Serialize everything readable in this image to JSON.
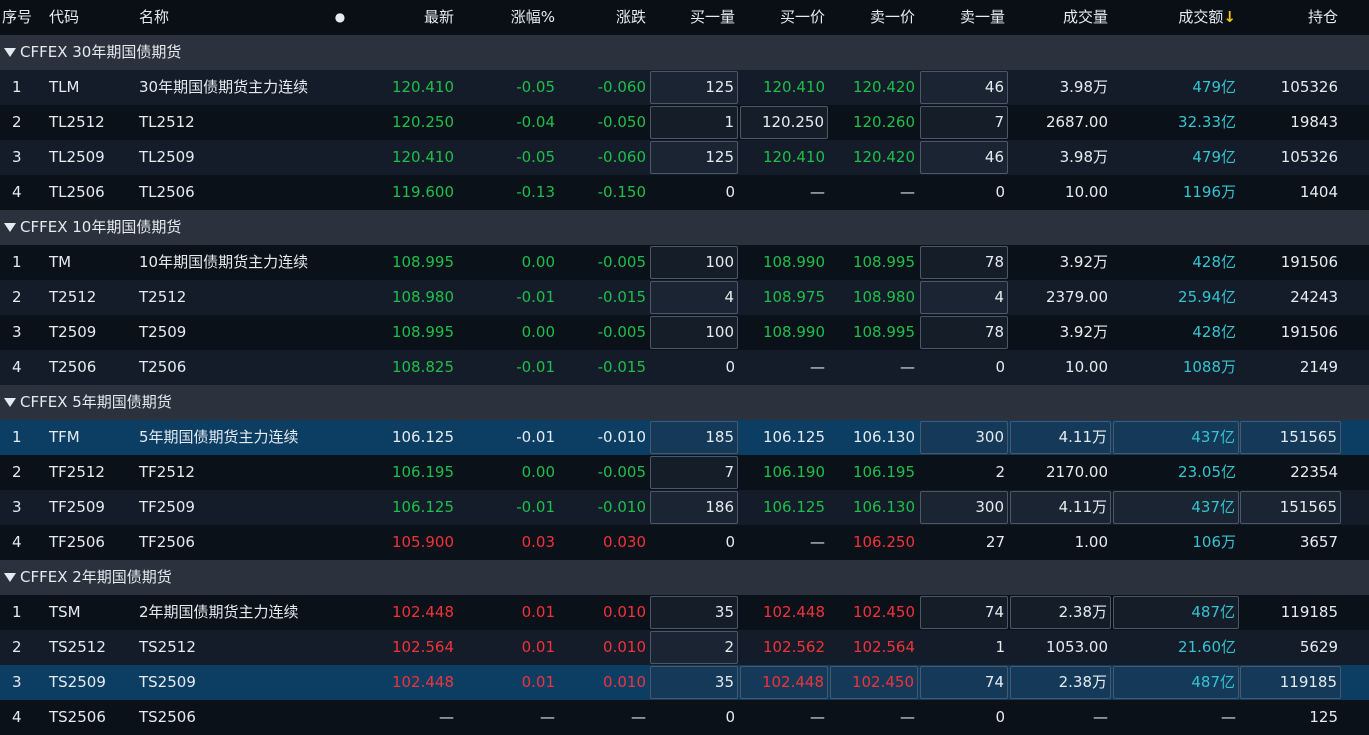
{
  "header": {
    "idx": "序号",
    "code": "代码",
    "name": "名称",
    "dot": "●",
    "last": "最新",
    "pct": "涨幅%",
    "chg": "涨跌",
    "bid_qty": "买一量",
    "bid": "买一价",
    "ask": "卖一价",
    "ask_qty": "卖一量",
    "vol": "成交量",
    "amt": "成交额",
    "amt_arrow": "↓",
    "oi": "持仓"
  },
  "groups": [
    {
      "title": "CFFEX 30年期国债期货",
      "rows": [
        {
          "idx": "1",
          "code": "TLM",
          "name": "30年期国债期货主力连续",
          "last": "120.410",
          "pct": "-0.05",
          "chg": "-0.060",
          "bid_qty": "125",
          "bid": "120.410",
          "ask": "120.420",
          "ask_qty": "46",
          "vol": "3.98万",
          "amt": "479亿",
          "oi": "105326",
          "color": "green",
          "bg": "odd",
          "boxes": [
            "bq",
            "aq"
          ]
        },
        {
          "idx": "2",
          "code": "TL2512",
          "name": "TL2512",
          "last": "120.250",
          "pct": "-0.04",
          "chg": "-0.050",
          "bid_qty": "1",
          "bid": "120.250",
          "ask": "120.260",
          "ask_qty": "7",
          "vol": "2687.00",
          "amt": "32.33亿",
          "oi": "19843",
          "color": "green",
          "bg": "even",
          "boxes": [
            "bq",
            "bp",
            "aq"
          ],
          "bp_white": true
        },
        {
          "idx": "3",
          "code": "TL2509",
          "name": "TL2509",
          "last": "120.410",
          "pct": "-0.05",
          "chg": "-0.060",
          "bid_qty": "125",
          "bid": "120.410",
          "ask": "120.420",
          "ask_qty": "46",
          "vol": "3.98万",
          "amt": "479亿",
          "oi": "105326",
          "color": "green",
          "bg": "odd",
          "boxes": [
            "bq",
            "aq"
          ]
        },
        {
          "idx": "4",
          "code": "TL2506",
          "name": "TL2506",
          "last": "119.600",
          "pct": "-0.13",
          "chg": "-0.150",
          "bid_qty": "0",
          "bid": "—",
          "ask": "—",
          "ask_qty": "0",
          "vol": "10.00",
          "amt": "1196万",
          "oi": "1404",
          "color": "green",
          "bg": "even",
          "boxes": [],
          "dash": true
        }
      ]
    },
    {
      "title": "CFFEX 10年期国债期货",
      "rows": [
        {
          "idx": "1",
          "code": "TM",
          "name": "10年期国债期货主力连续",
          "last": "108.995",
          "pct": "0.00",
          "chg": "-0.005",
          "bid_qty": "100",
          "bid": "108.990",
          "ask": "108.995",
          "ask_qty": "78",
          "vol": "3.92万",
          "amt": "428亿",
          "oi": "191506",
          "color": "green",
          "bg": "even",
          "boxes": [
            "bq",
            "aq"
          ]
        },
        {
          "idx": "2",
          "code": "T2512",
          "name": "T2512",
          "last": "108.980",
          "pct": "-0.01",
          "chg": "-0.015",
          "bid_qty": "4",
          "bid": "108.975",
          "ask": "108.980",
          "ask_qty": "4",
          "vol": "2379.00",
          "amt": "25.94亿",
          "oi": "24243",
          "color": "green",
          "bg": "odd",
          "boxes": [
            "bq",
            "aq"
          ]
        },
        {
          "idx": "3",
          "code": "T2509",
          "name": "T2509",
          "last": "108.995",
          "pct": "0.00",
          "chg": "-0.005",
          "bid_qty": "100",
          "bid": "108.990",
          "ask": "108.995",
          "ask_qty": "78",
          "vol": "3.92万",
          "amt": "428亿",
          "oi": "191506",
          "color": "green",
          "bg": "even",
          "boxes": [
            "bq",
            "aq"
          ]
        },
        {
          "idx": "4",
          "code": "T2506",
          "name": "T2506",
          "last": "108.825",
          "pct": "-0.01",
          "chg": "-0.015",
          "bid_qty": "0",
          "bid": "—",
          "ask": "—",
          "ask_qty": "0",
          "vol": "10.00",
          "amt": "1088万",
          "oi": "2149",
          "color": "green",
          "bg": "odd",
          "boxes": [],
          "dash": true
        }
      ]
    },
    {
      "title": "CFFEX 5年期国债期货",
      "rows": [
        {
          "idx": "1",
          "code": "TFM",
          "name": "5年期国债期货主力连续",
          "last": "106.125",
          "pct": "-0.01",
          "chg": "-0.010",
          "bid_qty": "185",
          "bid": "106.125",
          "ask": "106.130",
          "ask_qty": "300",
          "vol": "4.11万",
          "amt": "437亿",
          "oi": "151565",
          "color": "white",
          "bg": "sel",
          "boxes": [
            "bq",
            "aq",
            "vol",
            "amt",
            "oi"
          ]
        },
        {
          "idx": "2",
          "code": "TF2512",
          "name": "TF2512",
          "last": "106.195",
          "pct": "0.00",
          "chg": "-0.005",
          "bid_qty": "7",
          "bid": "106.190",
          "ask": "106.195",
          "ask_qty": "2",
          "vol": "2170.00",
          "amt": "23.05亿",
          "oi": "22354",
          "color": "green",
          "bg": "even",
          "boxes": [
            "bq"
          ]
        },
        {
          "idx": "3",
          "code": "TF2509",
          "name": "TF2509",
          "last": "106.125",
          "pct": "-0.01",
          "chg": "-0.010",
          "bid_qty": "186",
          "bid": "106.125",
          "ask": "106.130",
          "ask_qty": "300",
          "vol": "4.11万",
          "amt": "437亿",
          "oi": "151565",
          "color": "green",
          "bg": "odd",
          "boxes": [
            "bq",
            "aq",
            "vol",
            "amt",
            "oi"
          ]
        },
        {
          "idx": "4",
          "code": "TF2506",
          "name": "TF2506",
          "last": "105.900",
          "pct": "0.03",
          "chg": "0.030",
          "bid_qty": "0",
          "bid": "—",
          "ask": "106.250",
          "ask_qty": "27",
          "vol": "1.00",
          "amt": "106万",
          "oi": "3657",
          "color": "red",
          "bg": "even",
          "boxes": [],
          "dash": true
        }
      ]
    },
    {
      "title": "CFFEX 2年期国债期货",
      "rows": [
        {
          "idx": "1",
          "code": "TSM",
          "name": "2年期国债期货主力连续",
          "last": "102.448",
          "pct": "0.01",
          "chg": "0.010",
          "bid_qty": "35",
          "bid": "102.448",
          "ask": "102.450",
          "ask_qty": "74",
          "vol": "2.38万",
          "amt": "487亿",
          "oi": "119185",
          "color": "red",
          "bg": "even",
          "boxes": [
            "bq",
            "aq",
            "vol",
            "amt"
          ]
        },
        {
          "idx": "2",
          "code": "TS2512",
          "name": "TS2512",
          "last": "102.564",
          "pct": "0.01",
          "chg": "0.010",
          "bid_qty": "2",
          "bid": "102.562",
          "ask": "102.564",
          "ask_qty": "1",
          "vol": "1053.00",
          "amt": "21.60亿",
          "oi": "5629",
          "color": "red",
          "bg": "odd",
          "boxes": [
            "bq"
          ]
        },
        {
          "idx": "3",
          "code": "TS2509",
          "name": "TS2509",
          "last": "102.448",
          "pct": "0.01",
          "chg": "0.010",
          "bid_qty": "35",
          "bid": "102.448",
          "ask": "102.450",
          "ask_qty": "74",
          "vol": "2.38万",
          "amt": "487亿",
          "oi": "119185",
          "color": "red",
          "bg": "sel",
          "boxes": [
            "bq",
            "bp",
            "ap",
            "aq",
            "vol",
            "amt",
            "oi"
          ]
        },
        {
          "idx": "4",
          "code": "TS2506",
          "name": "TS2506",
          "last": "—",
          "pct": "—",
          "chg": "—",
          "bid_qty": "0",
          "bid": "—",
          "ask": "—",
          "ask_qty": "0",
          "vol": "—",
          "amt": "—",
          "oi": "125",
          "color": "white",
          "bg": "even",
          "boxes": [],
          "dash": true
        }
      ]
    }
  ],
  "colors": {
    "green": "#1fbf4b",
    "red": "#f0333a",
    "cyan": "#35c4d0",
    "header_bg": "#0a0f16",
    "group_bg": "#2b323d",
    "selected_bg": "#0c3d63"
  }
}
